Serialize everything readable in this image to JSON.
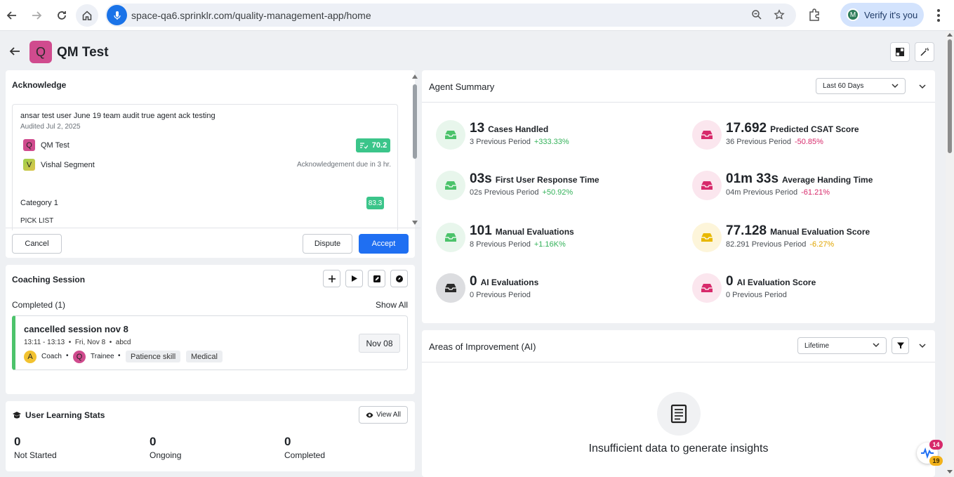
{
  "browser": {
    "url": "space-qa6.sprinklr.com/quality-management-app/home",
    "profile_initial": "M",
    "profile_label": "Verify it's you"
  },
  "page": {
    "avatar_letter": "Q",
    "title": "QM Test"
  },
  "acknowledge": {
    "title": "Acknowledge",
    "audit_title": "ansar test user June 19 team audit true agent ack testing",
    "audit_date": "Audited Jul 2, 2025",
    "rows": [
      {
        "avatar": "Q",
        "label": "QM Test",
        "score": "70.2"
      },
      {
        "avatar": "V",
        "label": "Vishal Segment",
        "due": "Acknowledgement due in 3 hr."
      }
    ],
    "category_label": "Category 1",
    "category_score": "83.3",
    "pick_list": "PICK LIST",
    "cancel": "Cancel",
    "dispute": "Dispute",
    "accept": "Accept"
  },
  "coaching": {
    "title": "Coaching Session",
    "completed_label": "Completed (1)",
    "show_all": "Show All",
    "session": {
      "name": "cancelled session nov 8",
      "time": "13:11 - 13:13",
      "date": "Fri, Nov 8",
      "extra": "abcd",
      "coach_avatar": "A",
      "coach_label": "Coach",
      "trainee_avatar": "Q",
      "trainee_label": "Trainee",
      "tags": [
        "Patience skill",
        "Medical"
      ],
      "badge_date": "Nov 08"
    }
  },
  "learning": {
    "title": "User Learning Stats",
    "view_all": "View All",
    "stats": [
      {
        "value": "0",
        "label": "Not Started"
      },
      {
        "value": "0",
        "label": "Ongoing"
      },
      {
        "value": "0",
        "label": "Completed"
      }
    ]
  },
  "agent_summary": {
    "title": "Agent Summary",
    "range": "Last 60 Days",
    "metrics": [
      {
        "value": "13",
        "label": "Cases Handled",
        "prev": "3 Previous Period",
        "change": "+333.33%",
        "trend": "up",
        "color": "#4cc36b",
        "bg": "#e8f6ec"
      },
      {
        "value": "17.692",
        "label": "Predicted CSAT Score",
        "prev": "36 Previous Period",
        "change": "-50.85%",
        "trend": "down",
        "color": "#d72a6b",
        "bg": "#fbe6ee"
      },
      {
        "value": "03s",
        "label": "First User Response Time",
        "prev": "02s Previous Period",
        "change": "+50.92%",
        "trend": "up",
        "color": "#4cc36b",
        "bg": "#e8f6ec"
      },
      {
        "value": "01m 33s",
        "label": "Average Handing Time",
        "prev": "04m Previous Period",
        "change": "-61.21%",
        "trend": "down",
        "color": "#d72a6b",
        "bg": "#fbe6ee"
      },
      {
        "value": "101",
        "label": "Manual Evaluations",
        "prev": "8 Previous Period",
        "change": "+1.16K%",
        "trend": "up",
        "color": "#4cc36b",
        "bg": "#e8f6ec"
      },
      {
        "value": "77.128",
        "label": "Manual Evaluation Score",
        "prev": "82.291 Previous Period",
        "change": "-6.27%",
        "trend": "warn",
        "color": "#e8b800",
        "bg": "#fdf5da"
      },
      {
        "value": "0",
        "label": "AI Evaluations",
        "prev": "0 Previous Period",
        "change": "",
        "trend": "none",
        "color": "#2b2b2b",
        "bg": "#dcdde0"
      },
      {
        "value": "0",
        "label": "AI Evaluation Score",
        "prev": "0 Previous Period",
        "change": "",
        "trend": "none",
        "color": "#d72a6b",
        "bg": "#fbe6ee"
      }
    ]
  },
  "areas_of_improvement": {
    "title": "Areas of Improvement (AI)",
    "range": "Lifetime",
    "empty_message": "Insufficient data to generate insights"
  },
  "fab": {
    "badge_top": "14",
    "badge_bottom": "19"
  }
}
